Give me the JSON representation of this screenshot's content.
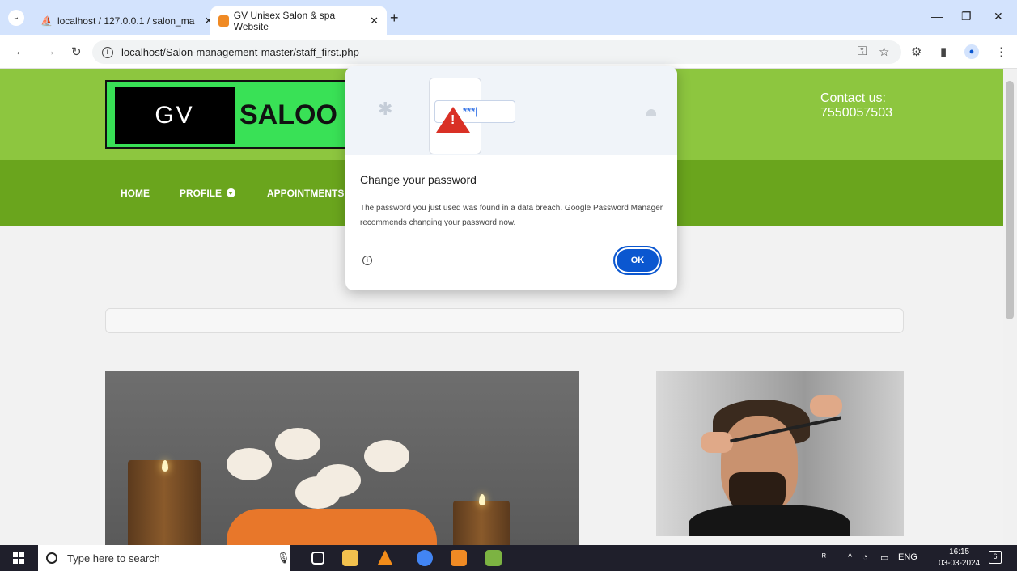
{
  "browser": {
    "tabs": [
      {
        "title": "localhost / 127.0.0.1 / salon_ma",
        "active": false
      },
      {
        "title": "GV Unisex Salon & spa Website",
        "active": true
      }
    ],
    "url": "localhost/Salon-management-master/staff_first.php"
  },
  "site": {
    "logo_left": "GV",
    "logo_right": "SALOO",
    "contact_label": "Contact us:",
    "contact_phone": "7550057503",
    "nav": [
      "HOME",
      "PROFILE",
      "APPOINTMENTS"
    ]
  },
  "dialog": {
    "field_text": "***|",
    "title": "Change your password",
    "body": "The password you just used was found in a data breach. Google Password Manager recommends changing your password now.",
    "ok_label": "OK"
  },
  "taskbar": {
    "search_placeholder": "Type here to search",
    "lang": "ENG",
    "time": "16:15",
    "date": "03-03-2024",
    "notif_count": "6"
  },
  "colors": {
    "header_green": "#8dc63f",
    "nav_green": "#6aa51d",
    "logo_green": "#39e156",
    "accent_blue": "#0b57d0",
    "warning_red": "#d93025"
  }
}
